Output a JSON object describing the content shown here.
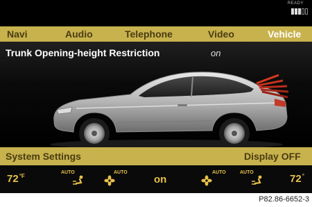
{
  "status": {
    "ready_label": "READY"
  },
  "nav": {
    "items": [
      {
        "label": "Navi"
      },
      {
        "label": "Audio"
      },
      {
        "label": "Telephone"
      },
      {
        "label": "Video"
      },
      {
        "label": "Vehicle"
      }
    ],
    "active": "Vehicle"
  },
  "main": {
    "title": "Trunk Opening-height Restriction",
    "status_text": "on"
  },
  "bottom_bar": {
    "left_label": "System Settings",
    "right_label": "Display OFF"
  },
  "climate": {
    "left_temp": "72",
    "left_unit": "°F",
    "right_temp": "72",
    "right_unit": "°",
    "auto_label": "AUTO",
    "center_label": "on"
  },
  "caption": "P82.86-6652-3",
  "colors": {
    "accent_bar": "#c7b24d",
    "active_nav": "#ffffff",
    "climate_text": "#e8c24a"
  }
}
